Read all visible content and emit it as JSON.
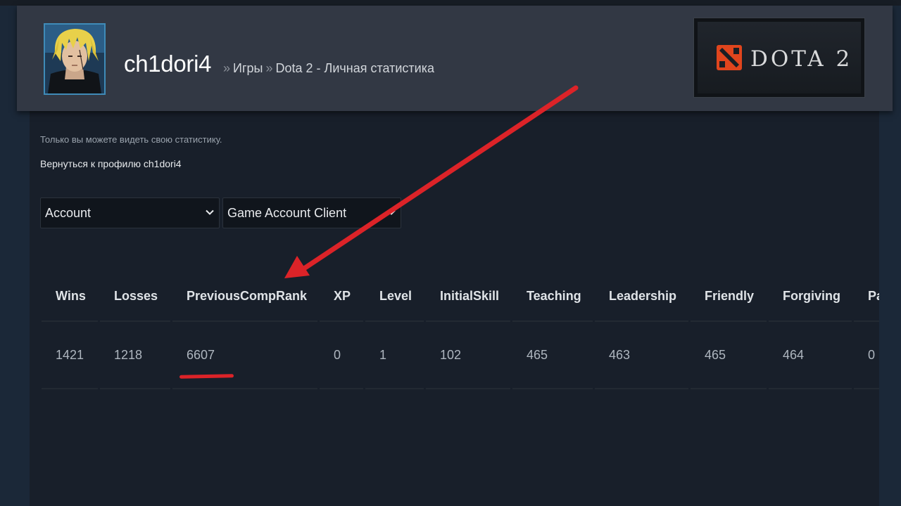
{
  "header": {
    "profile_name": "ch1dori4",
    "breadcrumb": {
      "separator": "»",
      "items": [
        "Игры",
        "Dota 2 - Личная статистика"
      ]
    },
    "game_logo": {
      "text": "DOTA 2",
      "icon": "dota2-emblem-icon",
      "emblem_color": "#e0451d"
    }
  },
  "notice": "Только вы можете видеть свою статистику.",
  "back_link": "Вернуться к профилю ch1dori4",
  "selects": [
    {
      "value": "Account",
      "icon": "chevron-down-icon"
    },
    {
      "value": "Game Account Client",
      "icon": "chevron-down-icon"
    }
  ],
  "stats_table": {
    "columns": [
      "Wins",
      "Losses",
      "PreviousCompRank",
      "XP",
      "Level",
      "InitialSkill",
      "Teaching",
      "Leadership",
      "Friendly",
      "Forgiving",
      "Partne"
    ],
    "rows": [
      [
        "1421",
        "1218",
        "6607",
        "0",
        "1",
        "102",
        "465",
        "463",
        "465",
        "464",
        "0"
      ]
    ]
  },
  "annotation": {
    "color": "#dc2328",
    "highlighted_column": "PreviousCompRank",
    "highlighted_value": "6607"
  }
}
